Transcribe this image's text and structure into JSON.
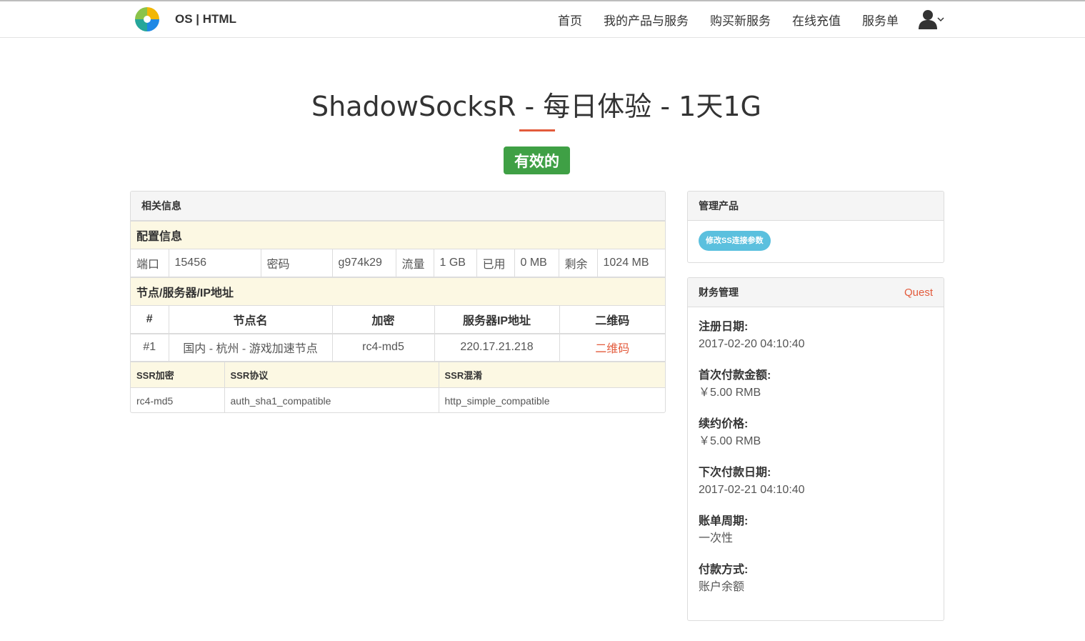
{
  "header": {
    "brand": "OS | HTML",
    "nav": [
      "首页",
      "我的产品与服务",
      "购买新服务",
      "在线充值",
      "服务单"
    ],
    "user_icon": "user-icon"
  },
  "page": {
    "title": "ShadowSocksR - 每日体验 - 1天1G",
    "status": "有效的",
    "status_color": "#3fa045",
    "accent_color": "#e35b3c"
  },
  "info_panel": {
    "heading": "相关信息",
    "config_section": "配置信息",
    "config": {
      "port_label": "端口",
      "port": "15456",
      "password_label": "密码",
      "password": "g974k29",
      "traffic_label": "流量",
      "traffic": "1 GB",
      "used_label": "已用",
      "used": "0 MB",
      "remaining_label": "剩余",
      "remaining": "1024 MB"
    },
    "node_section": "节点/服务器/IP地址",
    "node_headers": [
      "#",
      "节点名",
      "加密",
      "服务器IP地址",
      "二维码"
    ],
    "node_rows": [
      {
        "index": "#1",
        "name": "国内 - 杭州 - 游戏加速节点",
        "encryption": "rc4-md5",
        "ip": "220.17.21.218",
        "qr": "二维码"
      }
    ],
    "ssr_headers": [
      "SSR加密",
      "SSR协议",
      "SSR混淆"
    ],
    "ssr_values": [
      "rc4-md5",
      "auth_sha1_compatible",
      "http_simple_compatible"
    ]
  },
  "manage_panel": {
    "heading": "管理产品",
    "button": "修改SS连接参数",
    "button_color": "#5bc0de"
  },
  "finance_panel": {
    "heading": "财务管理",
    "link": "Quest",
    "items": [
      {
        "label": "注册日期:",
        "value": "2017-02-20 04:10:40"
      },
      {
        "label": "首次付款金额:",
        "value": "￥5.00 RMB"
      },
      {
        "label": "续约价格:",
        "value": "￥5.00 RMB"
      },
      {
        "label": "下次付款日期:",
        "value": "2017-02-21 04:10:40"
      },
      {
        "label": "账单周期:",
        "value": "一次性"
      },
      {
        "label": "付款方式:",
        "value": "账户余额"
      }
    ]
  }
}
